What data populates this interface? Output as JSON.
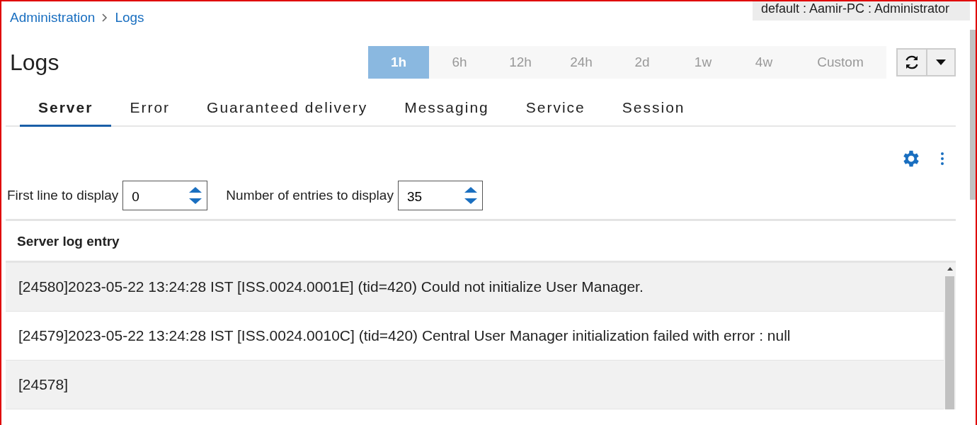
{
  "breadcrumb": [
    {
      "label": "Administration"
    },
    {
      "label": "Logs"
    }
  ],
  "user_info": "default : Aamir-PC : Administrator",
  "title": "Logs",
  "time_ranges": [
    {
      "label": "1h",
      "selected": true
    },
    {
      "label": "6h",
      "selected": false
    },
    {
      "label": "12h",
      "selected": false
    },
    {
      "label": "24h",
      "selected": false
    },
    {
      "label": "2d",
      "selected": false
    },
    {
      "label": "1w",
      "selected": false
    },
    {
      "label": "4w",
      "selected": false
    },
    {
      "label": "Custom",
      "selected": false
    }
  ],
  "tabs": [
    {
      "label": "Server",
      "selected": true
    },
    {
      "label": "Error",
      "selected": false
    },
    {
      "label": "Guaranteed delivery",
      "selected": false
    },
    {
      "label": "Messaging",
      "selected": false
    },
    {
      "label": "Service",
      "selected": false
    },
    {
      "label": "Session",
      "selected": false
    }
  ],
  "fields": [
    {
      "label": "First line to display",
      "value": "0"
    },
    {
      "label": "Number of entries to display",
      "value": "35"
    }
  ],
  "table": {
    "columns": [
      "Server log entry"
    ],
    "rows": [
      [
        "[24580]2023-05-22 13:24:28 IST [ISS.0024.0001E] (tid=420) Could not initialize User Manager."
      ],
      [
        "[24579]2023-05-22 13:24:28 IST [ISS.0024.0010C] (tid=420) Central User Manager initialization failed with error : null"
      ],
      [
        "[24578]"
      ]
    ]
  }
}
